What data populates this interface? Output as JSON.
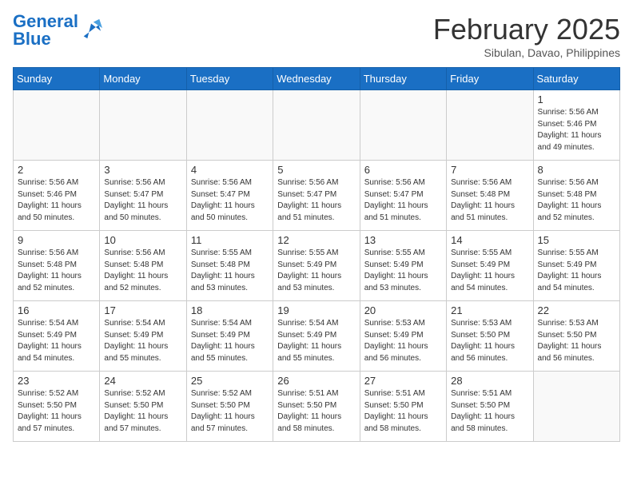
{
  "header": {
    "logo_general": "General",
    "logo_blue": "Blue",
    "month_title": "February 2025",
    "location": "Sibulan, Davao, Philippines"
  },
  "days_of_week": [
    "Sunday",
    "Monday",
    "Tuesday",
    "Wednesday",
    "Thursday",
    "Friday",
    "Saturday"
  ],
  "weeks": [
    [
      {
        "day": "",
        "info": ""
      },
      {
        "day": "",
        "info": ""
      },
      {
        "day": "",
        "info": ""
      },
      {
        "day": "",
        "info": ""
      },
      {
        "day": "",
        "info": ""
      },
      {
        "day": "",
        "info": ""
      },
      {
        "day": "1",
        "info": "Sunrise: 5:56 AM\nSunset: 5:46 PM\nDaylight: 11 hours\nand 49 minutes."
      }
    ],
    [
      {
        "day": "2",
        "info": "Sunrise: 5:56 AM\nSunset: 5:46 PM\nDaylight: 11 hours\nand 50 minutes."
      },
      {
        "day": "3",
        "info": "Sunrise: 5:56 AM\nSunset: 5:47 PM\nDaylight: 11 hours\nand 50 minutes."
      },
      {
        "day": "4",
        "info": "Sunrise: 5:56 AM\nSunset: 5:47 PM\nDaylight: 11 hours\nand 50 minutes."
      },
      {
        "day": "5",
        "info": "Sunrise: 5:56 AM\nSunset: 5:47 PM\nDaylight: 11 hours\nand 51 minutes."
      },
      {
        "day": "6",
        "info": "Sunrise: 5:56 AM\nSunset: 5:47 PM\nDaylight: 11 hours\nand 51 minutes."
      },
      {
        "day": "7",
        "info": "Sunrise: 5:56 AM\nSunset: 5:48 PM\nDaylight: 11 hours\nand 51 minutes."
      },
      {
        "day": "8",
        "info": "Sunrise: 5:56 AM\nSunset: 5:48 PM\nDaylight: 11 hours\nand 52 minutes."
      }
    ],
    [
      {
        "day": "9",
        "info": "Sunrise: 5:56 AM\nSunset: 5:48 PM\nDaylight: 11 hours\nand 52 minutes."
      },
      {
        "day": "10",
        "info": "Sunrise: 5:56 AM\nSunset: 5:48 PM\nDaylight: 11 hours\nand 52 minutes."
      },
      {
        "day": "11",
        "info": "Sunrise: 5:55 AM\nSunset: 5:48 PM\nDaylight: 11 hours\nand 53 minutes."
      },
      {
        "day": "12",
        "info": "Sunrise: 5:55 AM\nSunset: 5:49 PM\nDaylight: 11 hours\nand 53 minutes."
      },
      {
        "day": "13",
        "info": "Sunrise: 5:55 AM\nSunset: 5:49 PM\nDaylight: 11 hours\nand 53 minutes."
      },
      {
        "day": "14",
        "info": "Sunrise: 5:55 AM\nSunset: 5:49 PM\nDaylight: 11 hours\nand 54 minutes."
      },
      {
        "day": "15",
        "info": "Sunrise: 5:55 AM\nSunset: 5:49 PM\nDaylight: 11 hours\nand 54 minutes."
      }
    ],
    [
      {
        "day": "16",
        "info": "Sunrise: 5:54 AM\nSunset: 5:49 PM\nDaylight: 11 hours\nand 54 minutes."
      },
      {
        "day": "17",
        "info": "Sunrise: 5:54 AM\nSunset: 5:49 PM\nDaylight: 11 hours\nand 55 minutes."
      },
      {
        "day": "18",
        "info": "Sunrise: 5:54 AM\nSunset: 5:49 PM\nDaylight: 11 hours\nand 55 minutes."
      },
      {
        "day": "19",
        "info": "Sunrise: 5:54 AM\nSunset: 5:49 PM\nDaylight: 11 hours\nand 55 minutes."
      },
      {
        "day": "20",
        "info": "Sunrise: 5:53 AM\nSunset: 5:49 PM\nDaylight: 11 hours\nand 56 minutes."
      },
      {
        "day": "21",
        "info": "Sunrise: 5:53 AM\nSunset: 5:50 PM\nDaylight: 11 hours\nand 56 minutes."
      },
      {
        "day": "22",
        "info": "Sunrise: 5:53 AM\nSunset: 5:50 PM\nDaylight: 11 hours\nand 56 minutes."
      }
    ],
    [
      {
        "day": "23",
        "info": "Sunrise: 5:52 AM\nSunset: 5:50 PM\nDaylight: 11 hours\nand 57 minutes."
      },
      {
        "day": "24",
        "info": "Sunrise: 5:52 AM\nSunset: 5:50 PM\nDaylight: 11 hours\nand 57 minutes."
      },
      {
        "day": "25",
        "info": "Sunrise: 5:52 AM\nSunset: 5:50 PM\nDaylight: 11 hours\nand 57 minutes."
      },
      {
        "day": "26",
        "info": "Sunrise: 5:51 AM\nSunset: 5:50 PM\nDaylight: 11 hours\nand 58 minutes."
      },
      {
        "day": "27",
        "info": "Sunrise: 5:51 AM\nSunset: 5:50 PM\nDaylight: 11 hours\nand 58 minutes."
      },
      {
        "day": "28",
        "info": "Sunrise: 5:51 AM\nSunset: 5:50 PM\nDaylight: 11 hours\nand 58 minutes."
      },
      {
        "day": "",
        "info": ""
      }
    ]
  ]
}
